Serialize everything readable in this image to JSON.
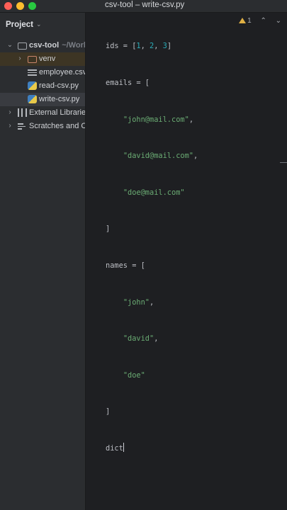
{
  "window": {
    "title": "csv-tool – write-csv.py"
  },
  "sidebar": {
    "header": "Project",
    "tree": [
      {
        "label": "csv-tool",
        "hint": "~/Work"
      },
      {
        "label": "venv"
      },
      {
        "label": "employee.csv"
      },
      {
        "label": "read-csv.py"
      },
      {
        "label": "write-csv.py"
      },
      {
        "label": "External Libraries"
      },
      {
        "label": "Scratches and C"
      }
    ]
  },
  "editor": {
    "inspection": {
      "warning_count": "1"
    },
    "code": {
      "l1": {
        "a": "ids = [",
        "n1": "1",
        "c1": ", ",
        "n2": "2",
        "c2": ", ",
        "n3": "3",
        "b": "]"
      },
      "l2": "emails = [",
      "l3": {
        "indent": "    ",
        "s": "\"john@mail.com\"",
        "t": ","
      },
      "l4": {
        "indent": "    ",
        "s": "\"david@mail.com\"",
        "t": ","
      },
      "l5": {
        "indent": "    ",
        "s": "\"doe@mail.com\"",
        "t": ""
      },
      "l6": "]",
      "l7": "names = [",
      "l8": {
        "indent": "    ",
        "s": "\"john\"",
        "t": ","
      },
      "l9": {
        "indent": "    ",
        "s": "\"david\"",
        "t": ","
      },
      "l10": {
        "indent": "    ",
        "s": "\"doe\"",
        "t": ""
      },
      "l11": "]",
      "l12": "dict"
    }
  },
  "colors": {
    "string": "#6aab73",
    "number": "#2aacb8",
    "default_text": "#bcbec4",
    "background": "#1e1f22",
    "sidebar_bg": "#2b2d30"
  }
}
